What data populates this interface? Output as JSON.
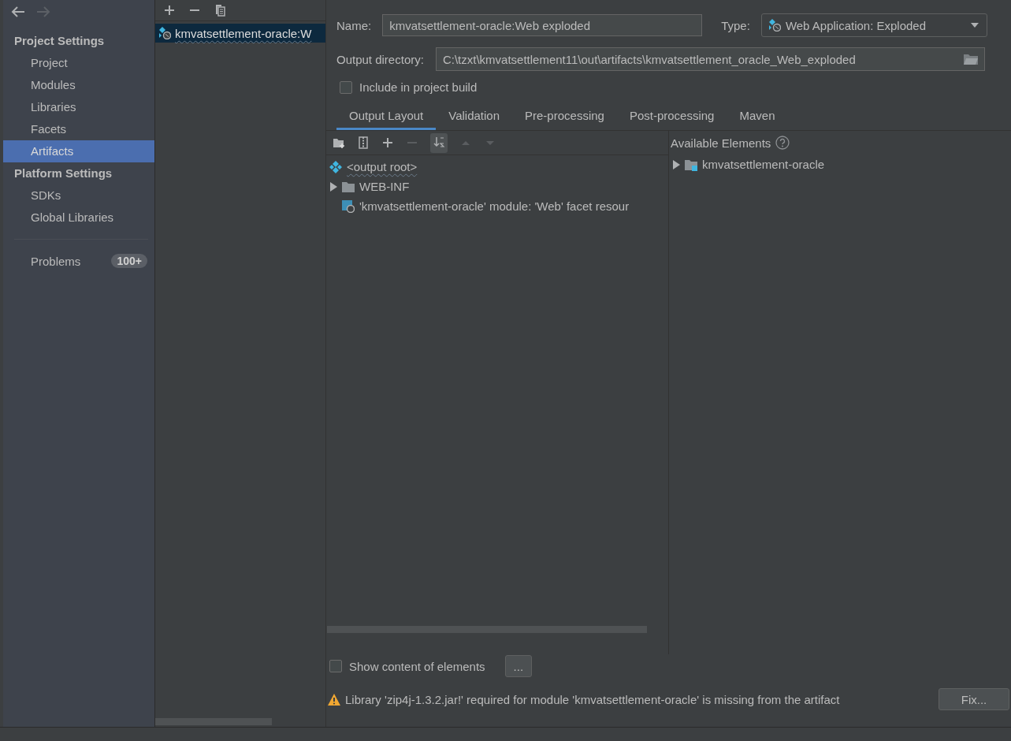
{
  "nav": {
    "back": {
      "disabled": false
    },
    "forward": {
      "disabled": true
    }
  },
  "sidebar": {
    "sections": [
      {
        "title": "Project Settings",
        "items": [
          {
            "label": "Project",
            "selected": false
          },
          {
            "label": "Modules",
            "selected": false
          },
          {
            "label": "Libraries",
            "selected": false
          },
          {
            "label": "Facets",
            "selected": false
          },
          {
            "label": "Artifacts",
            "selected": true
          }
        ]
      },
      {
        "title": "Platform Settings",
        "items": [
          {
            "label": "SDKs",
            "selected": false
          },
          {
            "label": "Global Libraries",
            "selected": false
          }
        ]
      }
    ],
    "problems": {
      "label": "Problems",
      "count": "100+"
    }
  },
  "artifact_toolbar": [
    {
      "kind": "add",
      "disabled": false
    },
    {
      "kind": "remove",
      "disabled": false
    },
    {
      "kind": "copy",
      "disabled": false
    }
  ],
  "artifacts": [
    {
      "label": "kmvatsettlement-oracle:W",
      "selected": true
    }
  ],
  "editor": {
    "name_label": "Name:",
    "name_value": "kmvatsettlement-oracle:Web exploded",
    "type_label": "Type:",
    "type_value": "Web Application: Exploded",
    "output_label": "Output directory:",
    "output_value": "C:\\tzxt\\kmvatsettlement11\\out\\artifacts\\kmvatsettlement_oracle_Web_exploded",
    "include_build": {
      "label": "Include in project build",
      "checked": false
    },
    "tabs": [
      {
        "label": "Output Layout",
        "selected": true
      },
      {
        "label": "Validation",
        "selected": false
      },
      {
        "label": "Pre-processing",
        "selected": false
      },
      {
        "label": "Post-processing",
        "selected": false
      },
      {
        "label": "Maven",
        "selected": false
      }
    ],
    "layout_toolbar": [
      {
        "kind": "new-folder",
        "disabled": false
      },
      {
        "kind": "archive",
        "disabled": false
      },
      {
        "kind": "add",
        "disabled": false
      },
      {
        "kind": "remove",
        "disabled": true
      },
      {
        "kind": "sort",
        "disabled": false,
        "selected": true
      },
      {
        "kind": "up",
        "disabled": true
      },
      {
        "kind": "down",
        "disabled": true
      }
    ],
    "layout_tree": [
      {
        "kind": "root",
        "label": "<output root>",
        "children": [
          {
            "kind": "folder",
            "label": "WEB-INF",
            "expanded": false
          },
          {
            "kind": "facet",
            "label": "'kmvatsettlement-oracle' module: 'Web' facet resour"
          }
        ]
      }
    ],
    "available": {
      "title": "Available Elements",
      "items": [
        {
          "label": "kmvatsettlement-oracle",
          "expanded": false
        }
      ]
    },
    "show_content": {
      "label": "Show content of elements",
      "checked": false
    },
    "more_button": "...",
    "warning": {
      "text": "Library 'zip4j-1.3.2.jar!' required for module 'kmvatsettlement-oracle' is missing from the artifact",
      "button": "Fix..."
    }
  }
}
